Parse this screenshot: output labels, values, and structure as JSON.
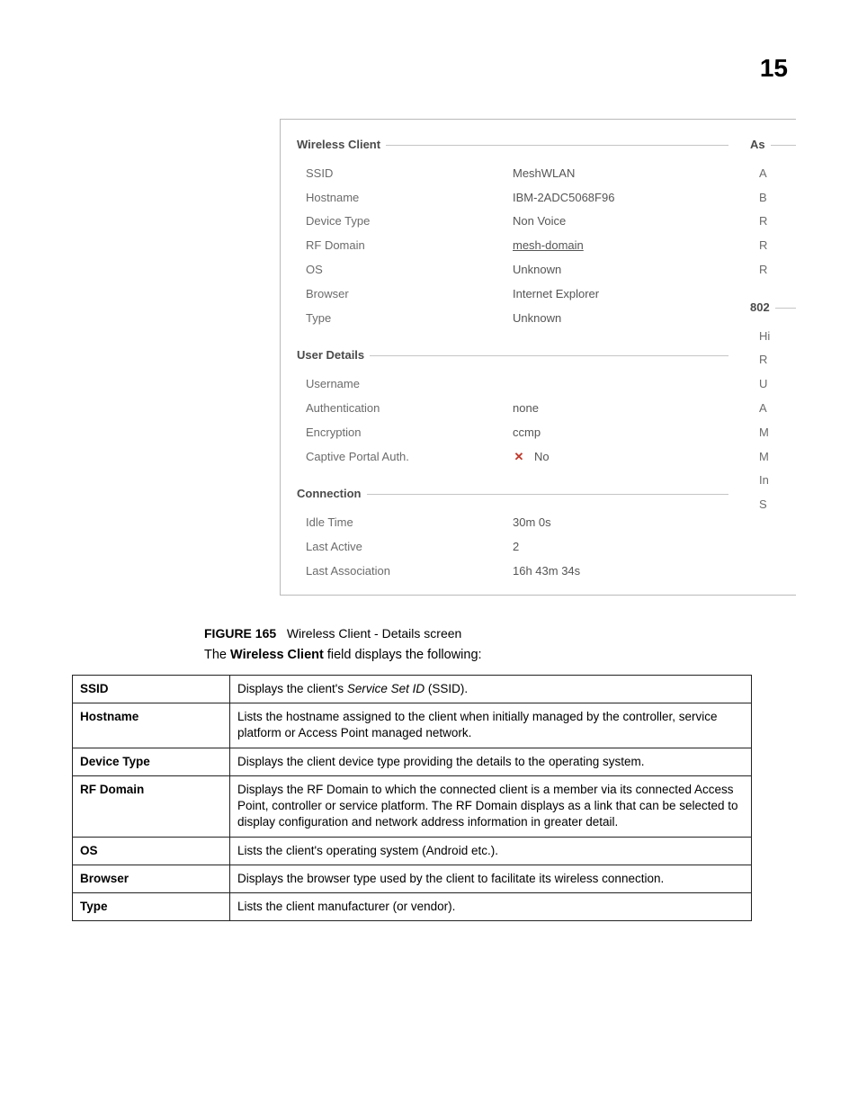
{
  "page_number": "15",
  "panel": {
    "wireless_client": {
      "legend": "Wireless Client",
      "ssid_label": "SSID",
      "ssid_value": "MeshWLAN",
      "hostname_label": "Hostname",
      "hostname_value": "IBM-2ADC5068F96",
      "device_type_label": "Device Type",
      "device_type_value": "Non Voice",
      "rf_domain_label": "RF Domain",
      "rf_domain_value": "mesh-domain",
      "os_label": "OS",
      "os_value": "Unknown",
      "browser_label": "Browser",
      "browser_value": "Internet Explorer",
      "type_label": "Type",
      "type_value": "Unknown"
    },
    "user_details": {
      "legend": "User Details",
      "username_label": "Username",
      "username_value": "",
      "authentication_label": "Authentication",
      "authentication_value": "none",
      "encryption_label": "Encryption",
      "encryption_value": "ccmp",
      "captive_portal_label": "Captive Portal Auth.",
      "captive_portal_value": "No"
    },
    "connection": {
      "legend": "Connection",
      "idle_time_label": "Idle Time",
      "idle_time_value": "30m 0s",
      "last_active_label": "Last Active",
      "last_active_value": "2",
      "last_assoc_label": "Last Association",
      "last_assoc_value": "16h 43m 34s"
    },
    "right": {
      "assoc_legend": "As",
      "assoc_rows": [
        "A",
        "B",
        "R",
        "R",
        "R"
      ],
      "dot11_legend": "802",
      "dot11_rows": [
        "Hi",
        "R",
        "U",
        "A",
        "M",
        "M",
        "In",
        "S"
      ]
    }
  },
  "figure": {
    "label": "FIGURE 165",
    "title": "Wireless Client - Details screen"
  },
  "intro": {
    "pre": "The ",
    "bold": "Wireless Client",
    "post": " field displays the following:"
  },
  "desc_table": [
    {
      "key": "SSID",
      "val_pre": "Displays the client's ",
      "val_italic": "Service Set ID",
      "val_post": " (SSID)."
    },
    {
      "key": "Hostname",
      "val": "Lists the hostname assigned to the client when initially managed by the controller, service platform or Access Point managed network."
    },
    {
      "key": "Device Type",
      "val": "Displays the client device type providing the details to the operating system."
    },
    {
      "key": "RF Domain",
      "val": "Displays the RF Domain to which the connected client is a member via its connected Access Point, controller or service platform. The RF Domain displays as a link that can be selected to display configuration and network address information in greater detail."
    },
    {
      "key": "OS",
      "val": "Lists the client's operating system (Android etc.)."
    },
    {
      "key": "Browser",
      "val": "Displays the browser type used by the client to facilitate its wireless connection."
    },
    {
      "key": "Type",
      "val": "Lists the client manufacturer (or vendor)."
    }
  ]
}
